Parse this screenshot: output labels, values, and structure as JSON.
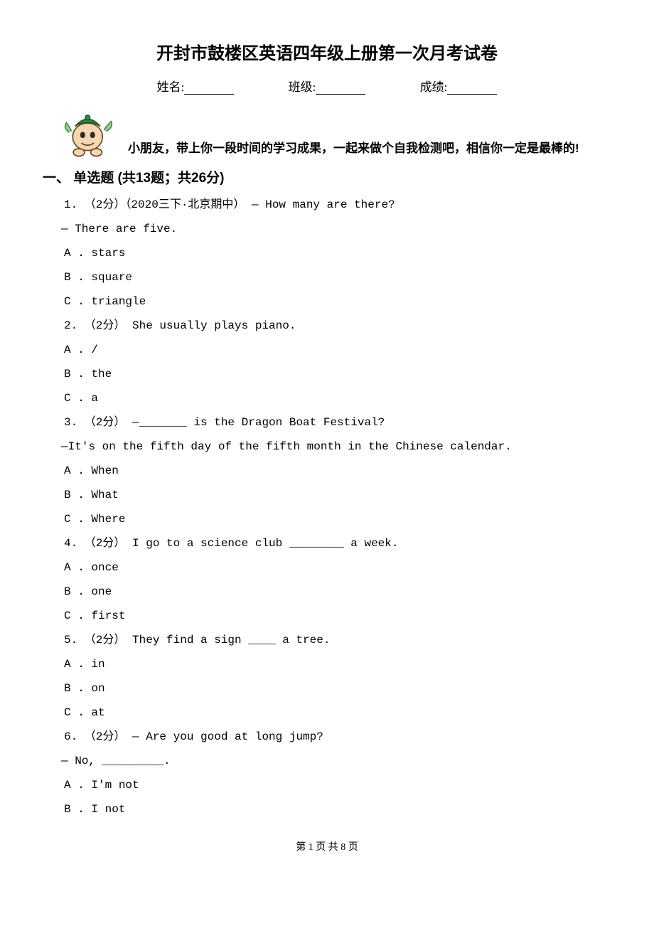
{
  "title": "开封市鼓楼区英语四年级上册第一次月考试卷",
  "info": {
    "name_label": "姓名:",
    "class_label": "班级:",
    "score_label": "成绩:"
  },
  "encourage": "小朋友，带上你一段时间的学习成果，一起来做个自我检测吧，相信你一定是最棒的!",
  "section1": "一、 单选题 (共13题；共26分)",
  "q1": {
    "line1": "1. （2分）（2020三下·北京期中） — How many             are there?",
    "line2": "— There are five.",
    "a": "A . stars",
    "b": "B . square",
    "c": "C . triangle"
  },
  "q2": {
    "line1": "2. （2分） She usually plays           piano.",
    "a": "A . /",
    "b": "B . the",
    "c": "C . a"
  },
  "q3": {
    "line1": "3. （2分） —_______ is the Dragon Boat Festival?",
    "line2": "—It's on the fifth day of the fifth month in the Chinese calendar.",
    "a": "A . When",
    "b": "B . What",
    "c": "C . Where"
  },
  "q4": {
    "line1": "4. （2分） I go to a science club ________ a week.",
    "a": "A . once",
    "b": "B . one",
    "c": "C . first"
  },
  "q5": {
    "line1": "5. （2分） They find a sign ____ a tree.",
    "a": "A . in",
    "b": "B . on",
    "c": "C . at"
  },
  "q6": {
    "line1": "6. （2分） — Are you good at long jump?",
    "line2": "— No, _________.",
    "a": "A . I'm not",
    "b": "B . I not"
  },
  "footer": "第 1 页 共 8 页"
}
